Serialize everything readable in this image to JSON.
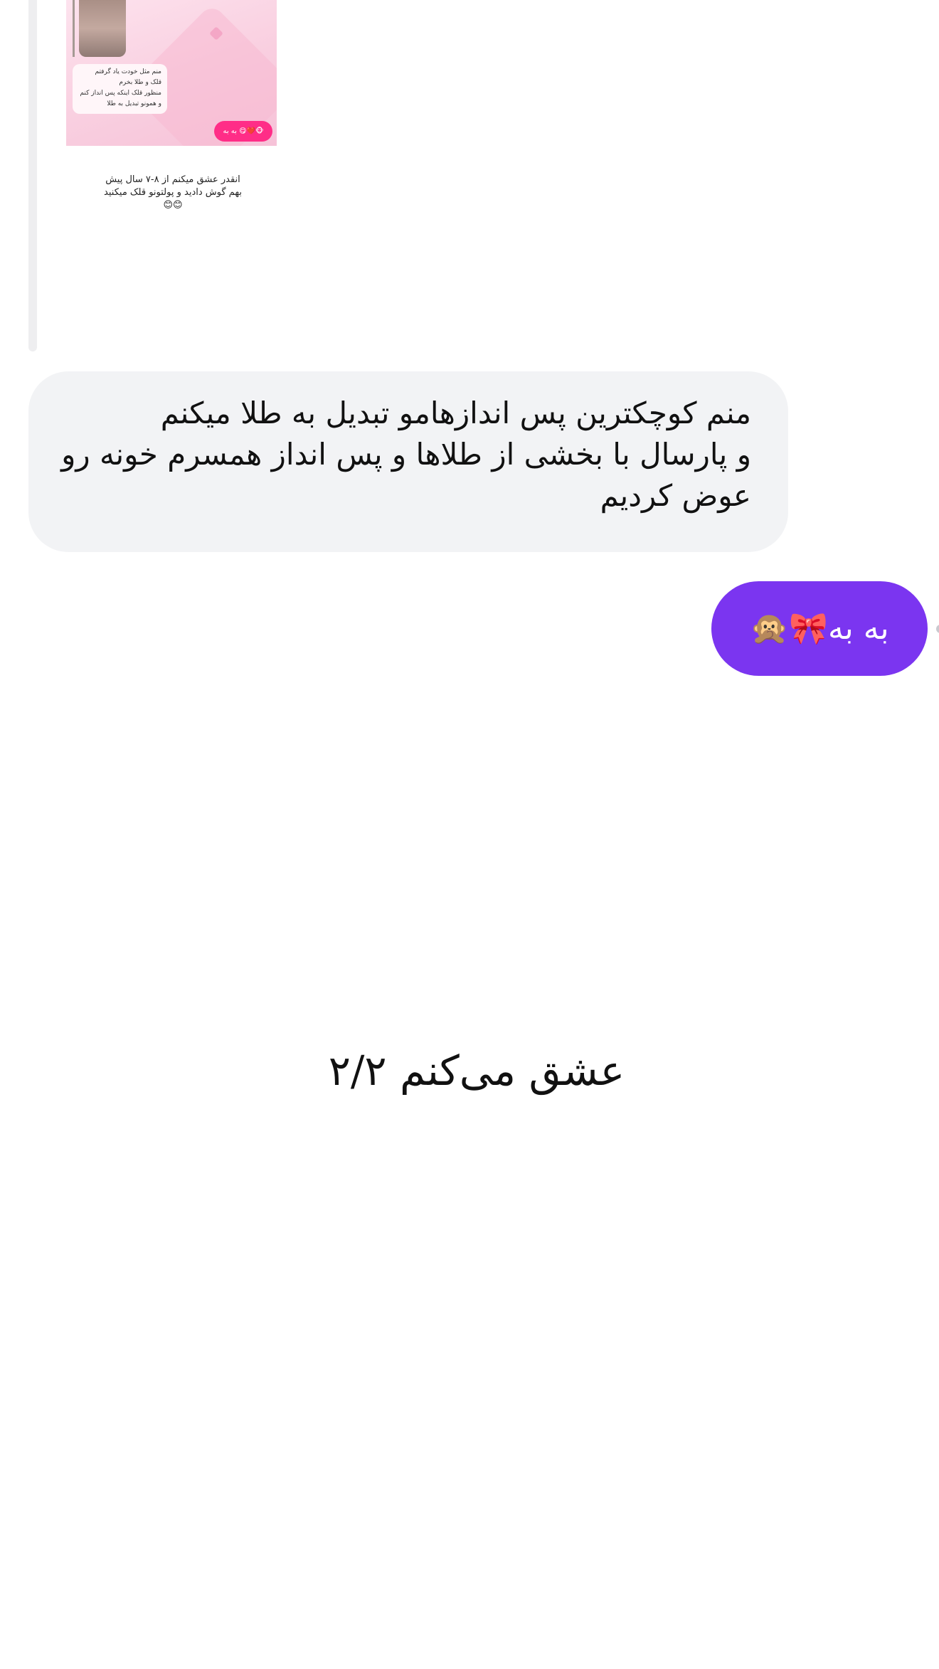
{
  "story_reply": {
    "note_lines": [
      "منم مثل خودت یاد گرفتم",
      "قلک و طلا بخرم",
      "منظور قلک اینکه پس انداز کنم",
      "و همونو تبدیل به طلا"
    ],
    "pill_label": "🐵❤️😋 به به",
    "caption_lines": [
      "انقدر عشق میکنم از ۸-۷ سال پیش",
      "بهم گوش دادید و پولتونو قلک میکنید",
      "😊😊"
    ]
  },
  "messages": {
    "received": {
      "lines": [
        "منم کوچکترین پس اندازهامو تبدیل به طلا میکنم",
        "و پارسال با بخشی از طلاها و پس انداز همسرم خونه رو",
        "عوض کردیم"
      ]
    },
    "sent": {
      "text": "به به🎀🙊"
    }
  },
  "footer": {
    "page_counter": "عشق می‌کنم ۲/۲"
  }
}
